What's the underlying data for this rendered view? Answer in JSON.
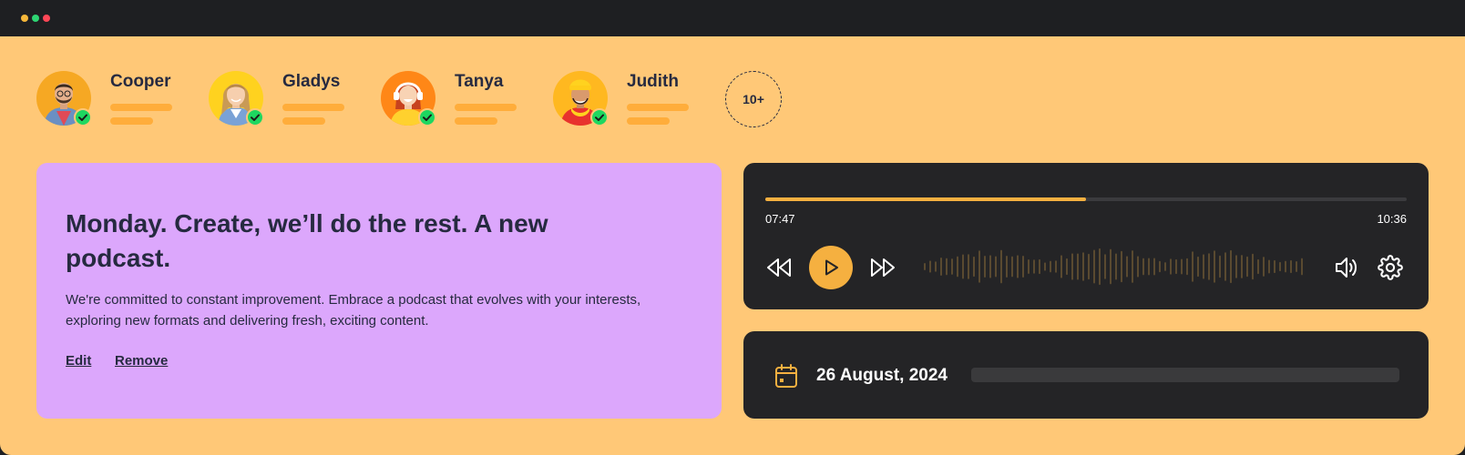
{
  "window": {
    "controls": [
      "minimize",
      "maximize",
      "close"
    ]
  },
  "colors": {
    "background": "#ffc877",
    "accent": "#f5b040",
    "card_purple": "#dca7fc",
    "dark_panel": "#242426",
    "online": "#1ed760",
    "text_dark": "#262a40"
  },
  "participants": [
    {
      "name": "Cooper",
      "status": "online",
      "avatar_bg": "#f6a823"
    },
    {
      "name": "Gladys",
      "status": "online",
      "avatar_bg": "#ffd21f"
    },
    {
      "name": "Tanya",
      "status": "online",
      "avatar_bg": "#ff8717"
    },
    {
      "name": "Judith",
      "status": "online",
      "avatar_bg": "#ffb820"
    }
  ],
  "more_participants": "10+",
  "podcast": {
    "title": "Monday. Create, we’ll do the rest. A new podcast.",
    "description": "We're committed to constant improvement. Embrace a podcast that evolves with your interests, exploring new formats and delivering fresh, exciting content.",
    "edit_label": "Edit",
    "remove_label": "Remove"
  },
  "player": {
    "current_time": "07:47",
    "total_time": "10:36",
    "progress": 0.5,
    "icons": [
      "rewind-icon",
      "play-icon",
      "fast-forward-icon",
      "volume-icon",
      "settings-icon"
    ]
  },
  "episode": {
    "date": "26 August, 2024",
    "icon": "calendar-icon"
  }
}
